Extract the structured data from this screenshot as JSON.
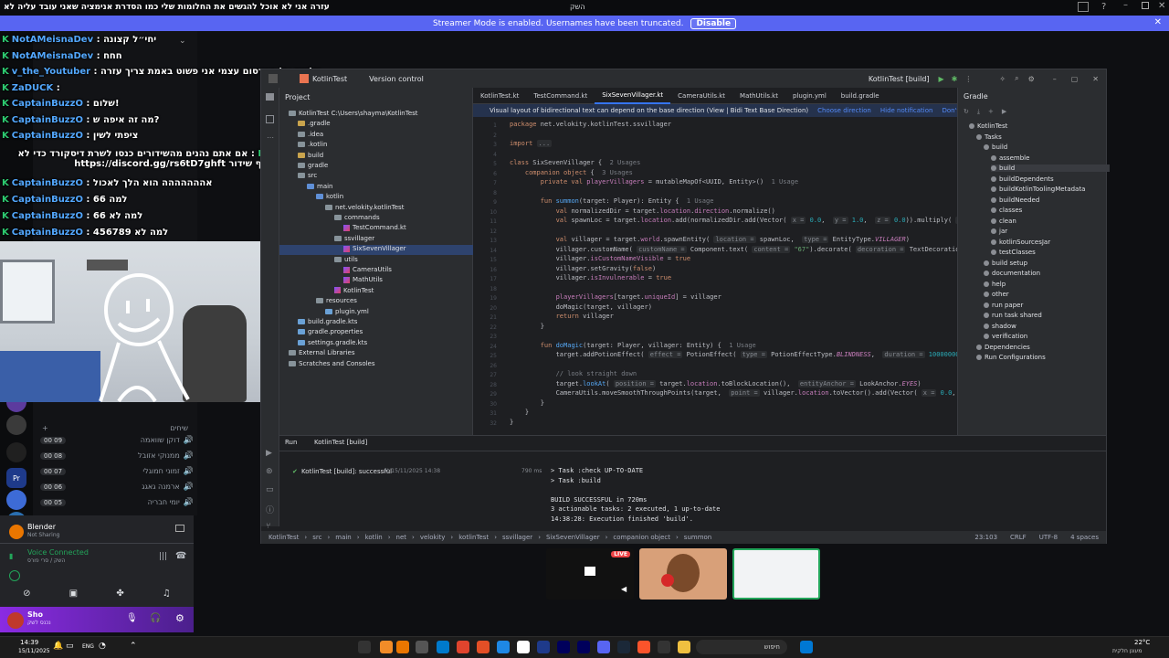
{
  "window": {
    "title": "השק"
  },
  "streamer": {
    "text": "Streamer Mode is enabled. Usernames have been truncated.",
    "button": "Disable"
  },
  "topline": "עזרה אני לא אוכל להגשים את החלומות שלי כמו הסדרת אנימציה שאני עובד עליה לא",
  "topline2": "הכלל",
  "chat": [
    {
      "user": "NotAMeisnaDev",
      "msg": "יחי״ל קצונה"
    },
    {
      "user": "NotAMeisnaDev",
      "msg": "חחח"
    },
    {
      "user": "v_the_Youtuber",
      "msg": "סליחה על הפרסום עצמי אני פשוט באמת צריך עזרה"
    },
    {
      "user": "ZaDUCK",
      "msg": ""
    },
    {
      "user": "CaptainBuzzO",
      "msg": "שלום!"
    },
    {
      "user": "CaptainBuzzO",
      "msg": "מה זה איפה ש?"
    },
    {
      "user": "CaptainBuzzO",
      "msg": "ציפתי לשין"
    },
    {
      "user": "BotRix",
      "msg": "אם אתם נהנים מהשידורים כנסו לשרת דיסקורד כדי לא לפספס אף שידור https://discord.gg/rs6tD7ghft"
    },
    {
      "user": "CaptainBuzzO",
      "msg": "אההההההה הוא הלך לאכול"
    },
    {
      "user": "CaptainBuzzO",
      "msg": "למה 66"
    },
    {
      "user": "CaptainBuzzO",
      "msg": "למה לא 66"
    },
    {
      "user": "CaptainBuzzO",
      "msg": "למה לא 456789"
    }
  ],
  "voice_channels": [
    {
      "name": "דוקן שוואמה",
      "count": "00 09"
    },
    {
      "name": "ממנוקי אזובל",
      "count": "00 08"
    },
    {
      "name": "זמוני חמוגלי",
      "count": "00 07"
    },
    {
      "name": "ארמנה גאגג",
      "count": "00 06"
    },
    {
      "name": "יומי חבריה",
      "count": "00 05"
    }
  ],
  "section_label": "שיחים",
  "app_status": {
    "name": "Blender",
    "sub": "Not Sharing"
  },
  "voice_status": {
    "title": "Voice Connected",
    "sub": "השק / סרי פורס"
  },
  "user": {
    "name": "Sho",
    "sub": "נכנס לשק"
  },
  "ide": {
    "project": "KotlinTest",
    "vcs": "Version control",
    "run_config": "KotlinTest [build]",
    "project_label": "Project",
    "tree": [
      {
        "t": "KotlinTest  C:\\Users\\shayma\\KotlinTest",
        "d": 0,
        "k": "folder"
      },
      {
        "t": ".gradle",
        "d": 1,
        "k": "ofolder"
      },
      {
        "t": ".idea",
        "d": 1,
        "k": "folder"
      },
      {
        "t": ".kotlin",
        "d": 1,
        "k": "folder"
      },
      {
        "t": "build",
        "d": 1,
        "k": "ofolder"
      },
      {
        "t": "gradle",
        "d": 1,
        "k": "folder"
      },
      {
        "t": "src",
        "d": 1,
        "k": "folder"
      },
      {
        "t": "main",
        "d": 2,
        "k": "bfolder"
      },
      {
        "t": "kotlin",
        "d": 3,
        "k": "bfolder"
      },
      {
        "t": "net.velokity.kotlinTest",
        "d": 4,
        "k": "folder"
      },
      {
        "t": "commands",
        "d": 5,
        "k": "folder"
      },
      {
        "t": "TestCommand.kt",
        "d": 6,
        "k": "kt"
      },
      {
        "t": "ssvillager",
        "d": 5,
        "k": "folder"
      },
      {
        "t": "SixSevenVillager",
        "d": 6,
        "k": "kt"
      },
      {
        "t": "utils",
        "d": 5,
        "k": "folder"
      },
      {
        "t": "CameraUtils",
        "d": 6,
        "k": "kt"
      },
      {
        "t": "MathUtils",
        "d": 6,
        "k": "kt"
      },
      {
        "t": "KotlinTest",
        "d": 5,
        "k": "kt"
      },
      {
        "t": "resources",
        "d": 3,
        "k": "folder"
      },
      {
        "t": "plugin.yml",
        "d": 4,
        "k": "file"
      },
      {
        "t": "build.gradle.kts",
        "d": 1,
        "k": "file"
      },
      {
        "t": "gradle.properties",
        "d": 1,
        "k": "file"
      },
      {
        "t": "settings.gradle.kts",
        "d": 1,
        "k": "file"
      },
      {
        "t": "External Libraries",
        "d": 0,
        "k": "folder"
      },
      {
        "t": "Scratches and Consoles",
        "d": 0,
        "k": "folder"
      }
    ],
    "tabs": [
      "KotlinTest.kt",
      "TestCommand.kt",
      "SixSevenVillager.kt",
      "CameraUtils.kt",
      "MathUtils.kt",
      "plugin.yml",
      "build.gradle"
    ],
    "banner": "Visual layout of bidirectional text can depend on the base direction (View | Bidi Text Base Direction)",
    "banner_links": [
      "Choose direction",
      "Hide notification",
      "Don't show again"
    ],
    "gradle_label": "Gradle",
    "gradle_tree": [
      "KotlinTest",
      "Tasks",
      "build",
      "assemble",
      "build",
      "buildDependents",
      "buildKotlinToolingMetadata",
      "buildNeeded",
      "classes",
      "clean",
      "jar",
      "kotlinSourcesJar",
      "testClasses",
      "build setup",
      "documentation",
      "help",
      "other",
      "run paper",
      "run task shared",
      "shadow",
      "verification",
      "Dependencies",
      "Run Configurations"
    ],
    "run_label": "Run",
    "run_tab": "KotlinTest [build]",
    "run_item": "KotlinTest [build]: successful",
    "run_time": "At 15/11/2025 14:38",
    "run_ms": "790 ms",
    "console": [
      "> Task :check UP-TO-DATE",
      "> Task :build",
      "",
      "BUILD SUCCESSFUL in 720ms",
      "3 actionable tasks: 2 executed, 1 up-to-date",
      "14:38:28: Execution finished 'build'."
    ],
    "status_path": [
      "KotlinTest",
      "src",
      "main",
      "kotlin",
      "net",
      "velokity",
      "kotlinTest",
      "ssvillager",
      "SixSevenVillager",
      "companion object",
      "summon"
    ],
    "status_right": [
      "23:103",
      "CRLF",
      "UTF-8",
      "4 spaces"
    ]
  },
  "taskbar": {
    "time": "14:39",
    "date": "15/11/2025",
    "lang": "ENG",
    "weather": "22°C",
    "weather_sub": "מעונן חלקית",
    "search": "חיפוש"
  },
  "thumb": {
    "live": "LIVE"
  },
  "colors": {
    "accent": "#5865f2",
    "ide_bg": "#1e1f22",
    "green": "#2ecc71"
  }
}
